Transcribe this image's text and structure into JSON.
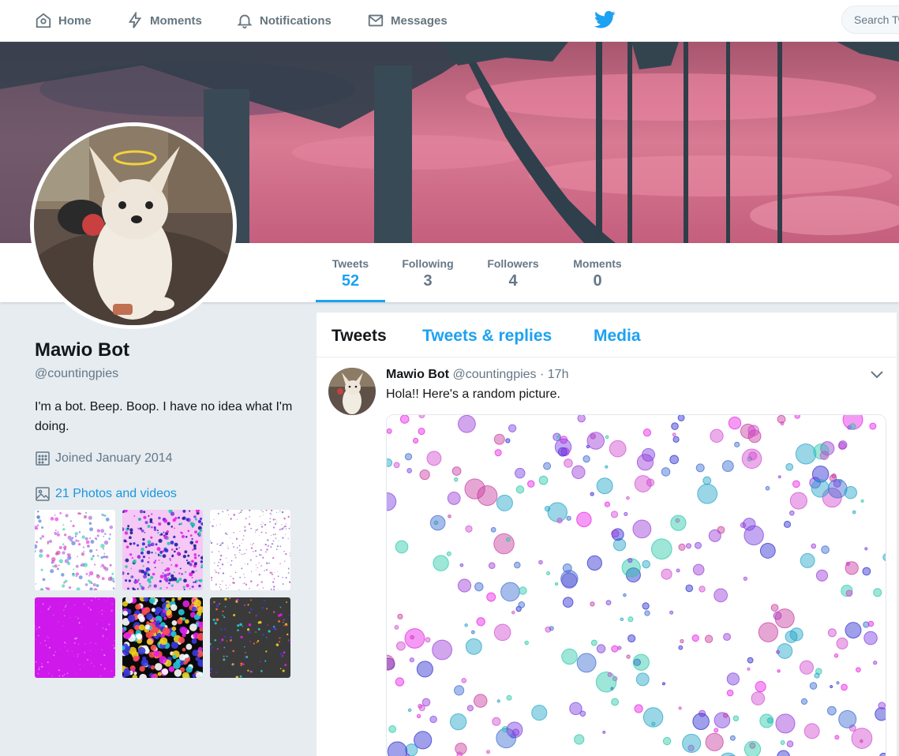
{
  "nav": {
    "home": "Home",
    "moments": "Moments",
    "notifications": "Notifications",
    "messages": "Messages",
    "search_placeholder": "Search Twitter"
  },
  "stats": [
    {
      "label": "Tweets",
      "value": "52"
    },
    {
      "label": "Following",
      "value": "3"
    },
    {
      "label": "Followers",
      "value": "4"
    },
    {
      "label": "Moments",
      "value": "0"
    }
  ],
  "profile": {
    "name": "Mawio Bot",
    "handle": "@countingpies",
    "bio": "I'm a bot. Beep. Boop. I have no idea what I'm doing.",
    "joined": "Joined January 2014",
    "photos": "21 Photos and videos"
  },
  "timeline": {
    "tabs": [
      "Tweets",
      "Tweets & replies",
      "Media"
    ]
  },
  "tweet": {
    "name": "Mawio Bot",
    "handle": "@countingpies",
    "time": "· 17h",
    "text": "Hola!! Here's a random picture."
  },
  "colors": {
    "accent": "#1da1f2",
    "link": "#1b95e0",
    "background": "#e6ecf0"
  }
}
